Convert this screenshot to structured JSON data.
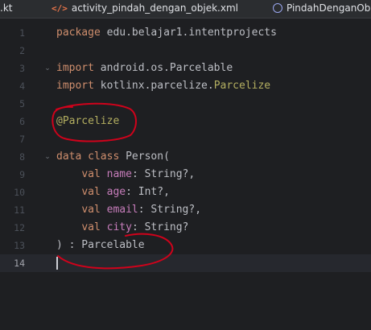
{
  "tabs": [
    {
      "label": ".kt"
    },
    {
      "label": "activity_pindah_dengan_objek.xml",
      "icon": "xml-tag-icon"
    },
    {
      "label": "PindahDenganOb",
      "icon": "class-icon"
    }
  ],
  "code_lines": [
    {
      "n": "1"
    },
    {
      "n": "2"
    },
    {
      "n": "3"
    },
    {
      "n": "4"
    },
    {
      "n": "5"
    },
    {
      "n": "6"
    },
    {
      "n": "7"
    },
    {
      "n": "8"
    },
    {
      "n": "9"
    },
    {
      "n": "10"
    },
    {
      "n": "11"
    },
    {
      "n": "12"
    },
    {
      "n": "13"
    },
    {
      "n": "14"
    }
  ],
  "code": {
    "l1_kw": "package",
    "l1_rest": " edu.belajar1.intentprojects",
    "l3_kw": "import",
    "l3_rest": " android.os.Parcelable",
    "l4_kw": "import",
    "l4_rest": " kotlinx.parcelize.",
    "l4_cls": "Parcelize",
    "l6_ann": "@Parcelize",
    "l8_kw": "data class",
    "l8_rest": " Person(",
    "l9_kw": "val",
    "l9_prop": "name",
    "l9_type": ": String?,",
    "l10_kw": "val",
    "l10_prop": "age",
    "l10_type": ": Int?,",
    "l11_kw": "val",
    "l11_prop": "email",
    "l11_type": ": String?,",
    "l12_kw": "val",
    "l12_prop": "city",
    "l12_type": ": String?",
    "l13_text": ") : Parcelable"
  },
  "colors": {
    "keyword": "#cf8e6d",
    "annotation": "#b3ae60",
    "property": "#c77dbb",
    "text": "#bcbec4",
    "marker": "#d0021b"
  }
}
